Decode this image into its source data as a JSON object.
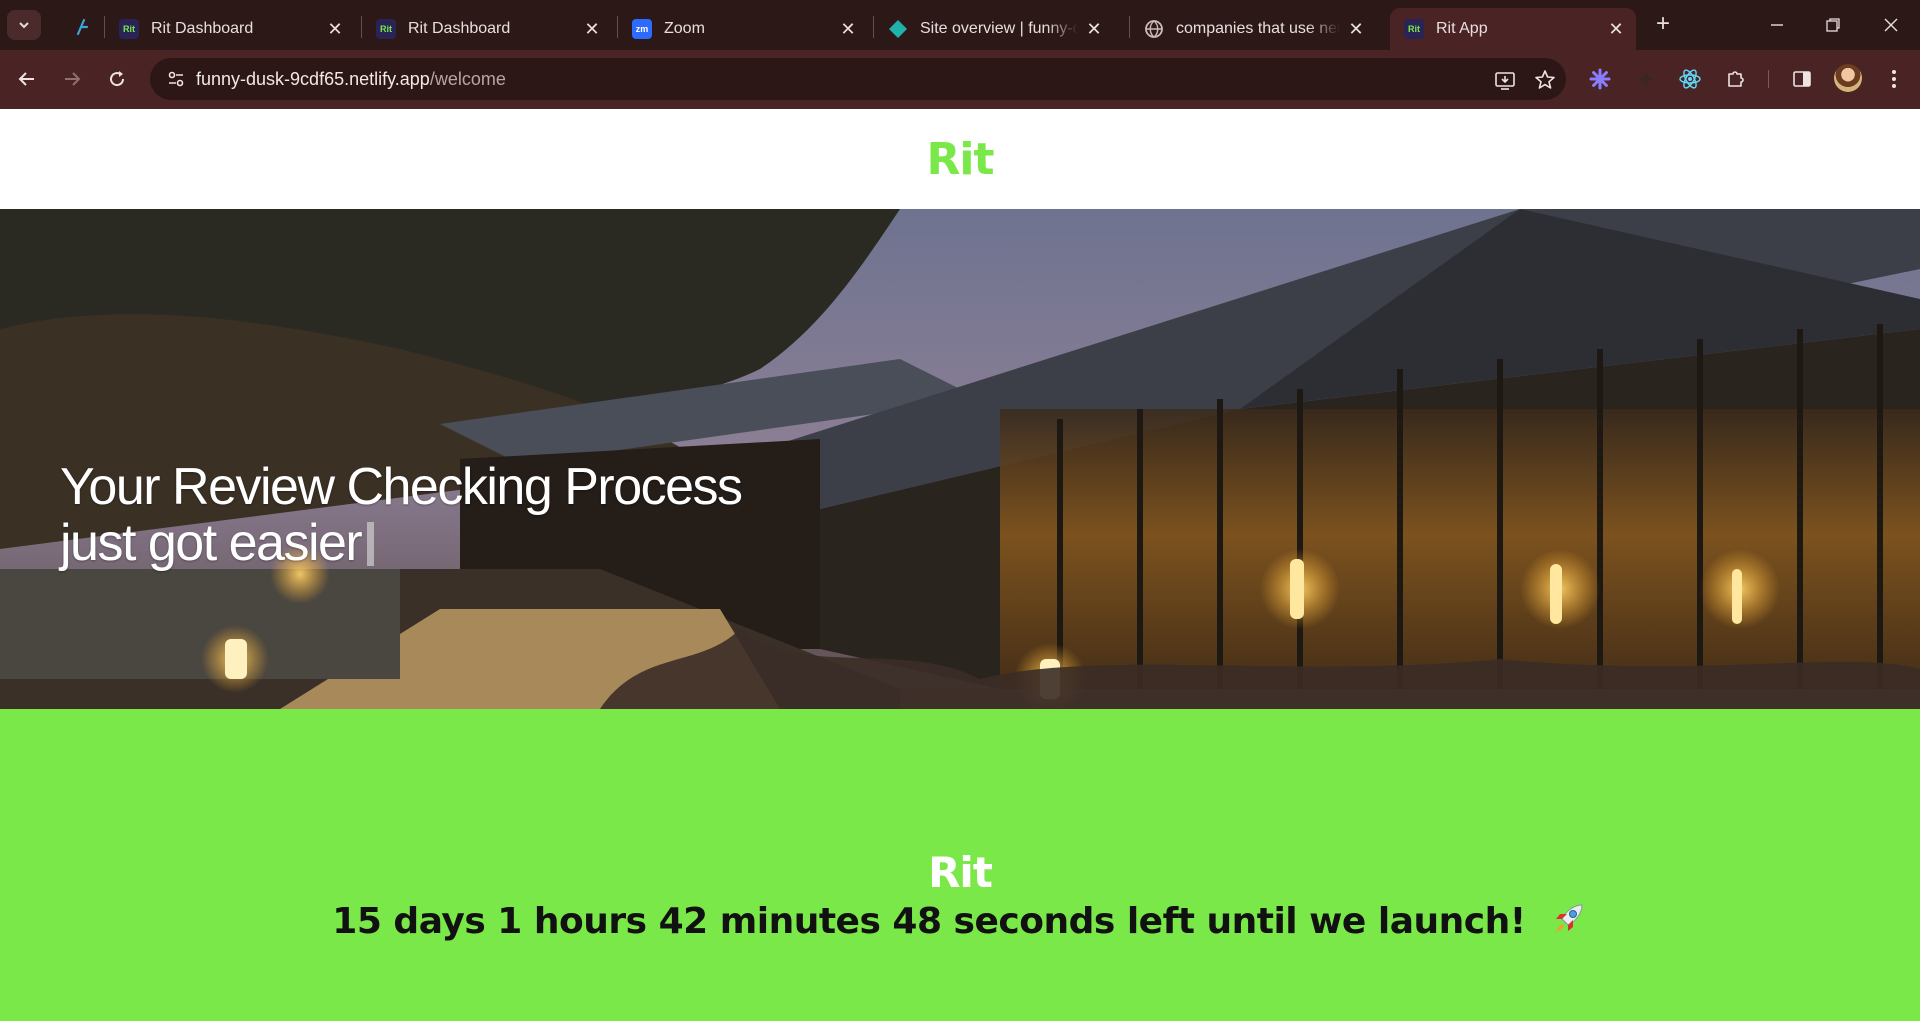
{
  "browser": {
    "tabs": [
      {
        "title": "",
        "icon": "netlify-icon",
        "active": false
      },
      {
        "title": "Rit Dashboard",
        "icon": "rit-favicon",
        "active": false
      },
      {
        "title": "Rit Dashboard",
        "icon": "rit-favicon",
        "active": false
      },
      {
        "title": "Zoom",
        "icon": "zoom-favicon",
        "active": false
      },
      {
        "title": "Site overview | funny-dusk",
        "icon": "netlify-site-favicon",
        "active": false
      },
      {
        "title": "companies that use netlify",
        "icon": "globe-icon",
        "active": false
      },
      {
        "title": "Rit App",
        "icon": "rit-favicon",
        "active": true
      }
    ],
    "favicon_text": {
      "rit": "Rit",
      "zoom": "zm"
    },
    "address": {
      "host": "funny-dusk-9cdf65.netlify.app",
      "path": "/welcome"
    }
  },
  "page": {
    "header_logo": "Rit",
    "hero": {
      "line1": "Your Review Checking Process",
      "line2": "just got easier"
    },
    "launch": {
      "logo": "Rit",
      "countdown": "15 days 1 hours 42 minutes 48 seconds left until we launch!",
      "emoji_icon": "rocket-icon"
    }
  },
  "colors": {
    "brand_green": "#7be84a",
    "chrome_dark": "#2d1818",
    "chrome_toolbar": "#4a2424"
  }
}
